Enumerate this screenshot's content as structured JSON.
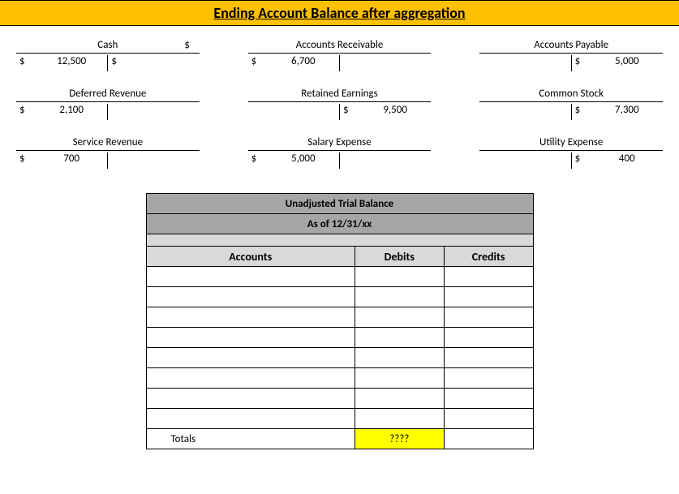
{
  "title": "Ending Account Balance after aggregation",
  "accounts": {
    "cash": {
      "name": "Cash",
      "left_currency": "$",
      "left_value": "12,500",
      "header_right": "$",
      "right_currency": "$",
      "right_value": ""
    },
    "ar": {
      "name": "Accounts Receivable",
      "left_currency": "$",
      "left_value": "6,700",
      "header_right": "",
      "right_currency": "",
      "right_value": ""
    },
    "ap": {
      "name": "Accounts Payable",
      "left_currency": "",
      "left_value": "",
      "header_right": "",
      "right_currency": "$",
      "right_value": "5,000"
    },
    "deferred_revenue": {
      "name": "Deferred Revenue",
      "left_currency": "",
      "left_value": "",
      "header_right": "",
      "right_currency": "$",
      "right_value": "2,100",
      "show_left_first": true
    },
    "retained_earnings": {
      "name": "Retained Earnings",
      "left_currency": "",
      "left_value": "",
      "header_right": "",
      "right_currency": "$",
      "right_value": "9,500"
    },
    "common_stock": {
      "name": "Common Stock",
      "left_currency": "",
      "left_value": "",
      "header_right": "",
      "right_currency": "$",
      "right_value": "7,300"
    },
    "service_revenue": {
      "name": "Service Revenue",
      "left_currency": "",
      "left_value": "",
      "header_right": "",
      "right_currency": "$",
      "right_value": "700",
      "show_left_first": true
    },
    "salary_expense": {
      "name": "Salary Expense",
      "left_currency": "$",
      "left_value": "5,000",
      "header_right": "",
      "right_currency": "",
      "right_value": ""
    },
    "utility_expense": {
      "name": "Utility Expense",
      "left_currency": "$",
      "left_value": "400",
      "header_right": "",
      "right_currency": "",
      "right_value": "",
      "right_pad": true
    }
  },
  "trial_balance": {
    "title": "Unadjusted Trial Balance",
    "subtitle": "As of 12/31/xx",
    "headers": {
      "accounts": "Accounts",
      "debits": "Debits",
      "credits": "Credits"
    },
    "empty_rows": 8,
    "totals": {
      "label": "Totals",
      "debits": "????",
      "credits": ""
    }
  },
  "chart_data": {
    "type": "table",
    "title": "Ending Account Balance after aggregation",
    "t_accounts": [
      {
        "account": "Cash",
        "debit": 12500,
        "credit": null
      },
      {
        "account": "Accounts Receivable",
        "debit": 6700,
        "credit": null
      },
      {
        "account": "Accounts Payable",
        "debit": null,
        "credit": 5000
      },
      {
        "account": "Deferred Revenue",
        "debit": null,
        "credit": 2100
      },
      {
        "account": "Retained Earnings",
        "debit": null,
        "credit": 9500
      },
      {
        "account": "Common Stock",
        "debit": null,
        "credit": 7300
      },
      {
        "account": "Service Revenue",
        "debit": null,
        "credit": 700
      },
      {
        "account": "Salary Expense",
        "debit": 5000,
        "credit": null
      },
      {
        "account": "Utility Expense",
        "debit": 400,
        "credit": null
      }
    ],
    "trial_balance": {
      "title": "Unadjusted Trial Balance",
      "as_of": "12/31/xx",
      "columns": [
        "Accounts",
        "Debits",
        "Credits"
      ],
      "rows": [],
      "totals": {
        "debits": "????",
        "credits": ""
      }
    }
  }
}
